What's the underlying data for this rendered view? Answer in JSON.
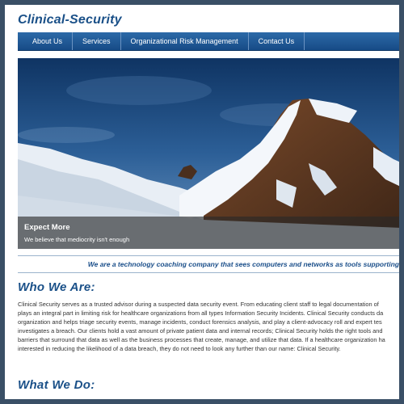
{
  "site": {
    "logo": "Clinical-Security"
  },
  "nav": {
    "items": [
      "About Us",
      "Services",
      "Organizational Risk Management",
      "Contact Us"
    ]
  },
  "hero": {
    "title": "Expect More",
    "subtitle": "We believe that mediocrity isn't enough"
  },
  "tagline": "We are a technology coaching company that sees computers and networks as tools supporting",
  "who": {
    "title": "Who We Are:",
    "lines": [
      "Clinical Security serves as a trusted advisor during a suspected data security event. From educating client staff to legal documentation of",
      "plays an integral part in limiting risk for healthcare organizations from all types Information Security Incidents. Clinical Security conducts da",
      "organization and helps triage security events, manage incidents, conduct forensics analysis, and play a client-advocacy roll and expert tes",
      "investigates a breach. Our clients hold a vast amount of private patient data and internal records; Clinical Security holds the right tools and",
      "barriers that surround that data as well as the business processes that create, manage, and utilize that data. If a healthcare organization ha",
      "interested in reducing the likelihood of a data breach, they do not need to look any further than our name: Clinical Security."
    ]
  },
  "what": {
    "title": "What We Do:"
  }
}
